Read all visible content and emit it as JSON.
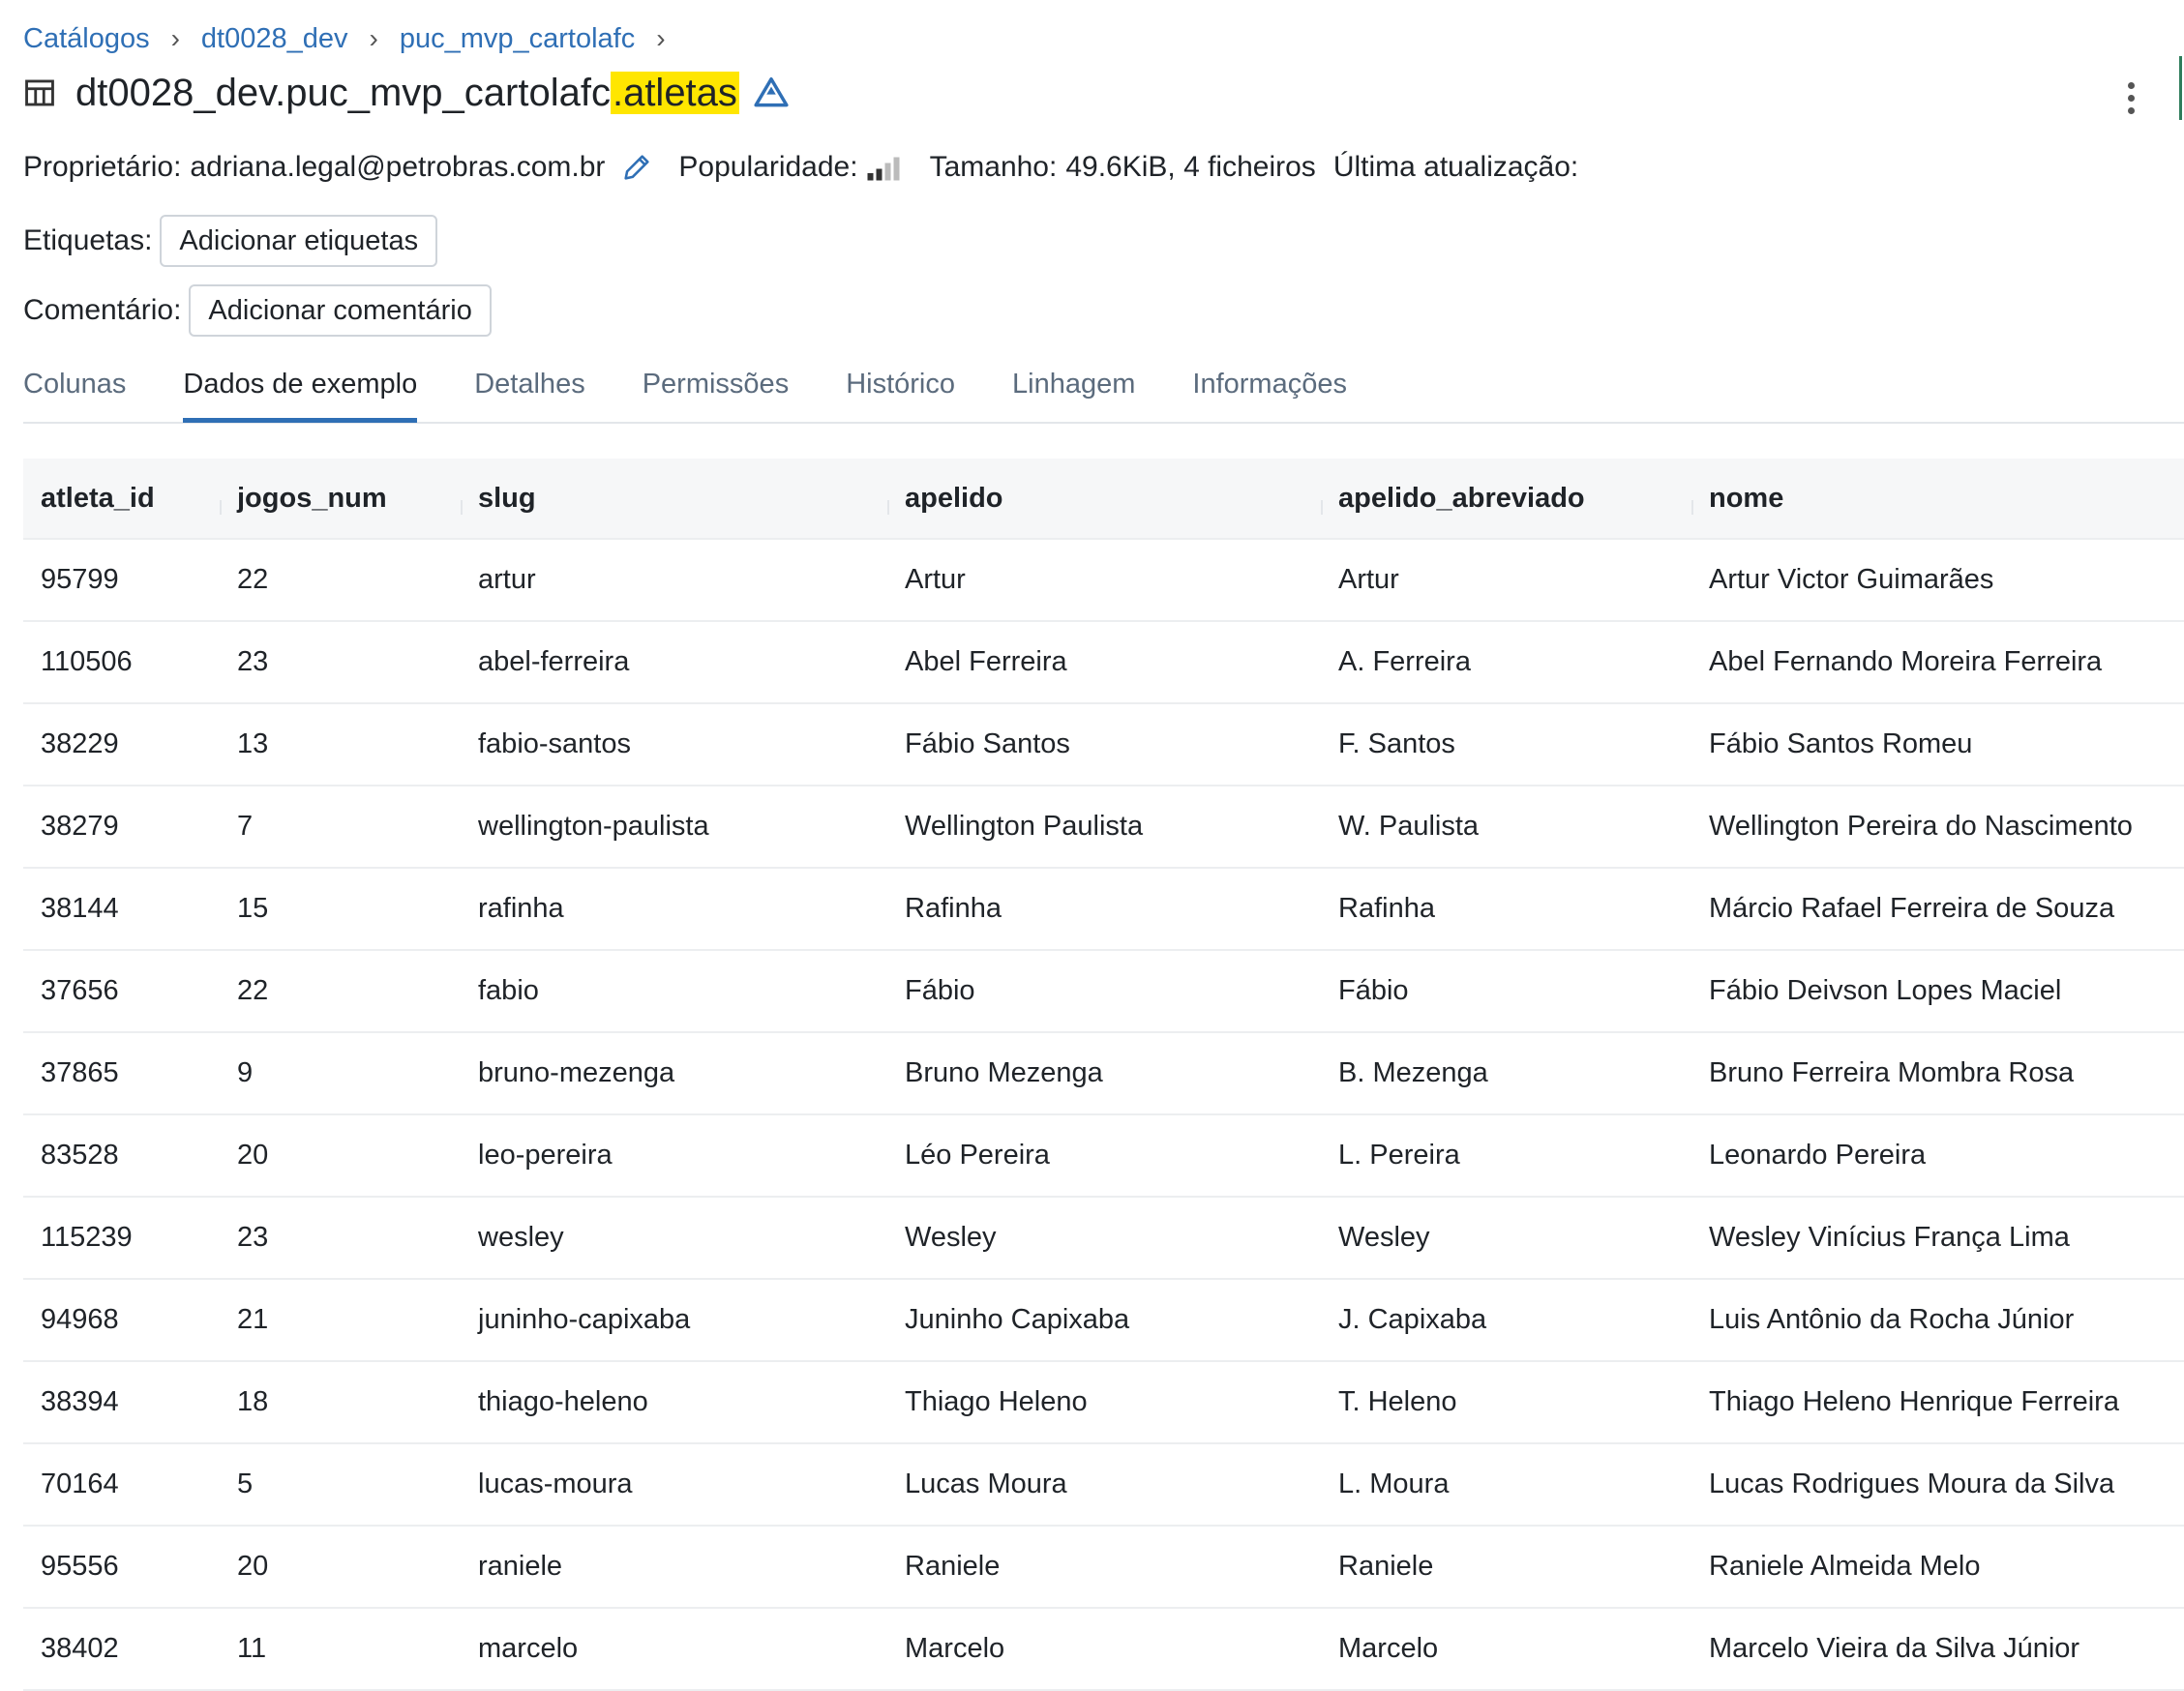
{
  "breadcrumb": [
    "Catálogos",
    "dt0028_dev",
    "puc_mvp_cartolafc"
  ],
  "title": {
    "prefix": "dt0028_dev.puc_mvp_cartolafc",
    "highlight": ".atletas"
  },
  "meta": {
    "owner_label": "Proprietário:",
    "owner_value": "adriana.legal@petrobras.com.br",
    "popularity_label": "Popularidade:",
    "size_label": "Tamanho:",
    "size_value": "49.6KiB, 4 ficheiros",
    "updated_label": "Última atualização:"
  },
  "tags": {
    "label": "Etiquetas:",
    "button": "Adicionar etiquetas"
  },
  "comment": {
    "label": "Comentário:",
    "button": "Adicionar comentário"
  },
  "tabs": [
    {
      "label": "Colunas",
      "active": false
    },
    {
      "label": "Dados de exemplo",
      "active": true
    },
    {
      "label": "Detalhes",
      "active": false
    },
    {
      "label": "Permissões",
      "active": false
    },
    {
      "label": "Histórico",
      "active": false
    },
    {
      "label": "Linhagem",
      "active": false
    },
    {
      "label": "Informações",
      "active": false
    }
  ],
  "table": {
    "columns": [
      "atleta_id",
      "jogos_num",
      "slug",
      "apelido",
      "apelido_abreviado",
      "nome"
    ],
    "rows": [
      [
        "95799",
        "22",
        "artur",
        "Artur",
        "Artur",
        "Artur Victor Guimarães"
      ],
      [
        "110506",
        "23",
        "abel-ferreira",
        "Abel Ferreira",
        "A. Ferreira",
        "Abel Fernando Moreira Ferreira"
      ],
      [
        "38229",
        "13",
        "fabio-santos",
        "Fábio Santos",
        "F. Santos",
        "Fábio Santos Romeu"
      ],
      [
        "38279",
        "7",
        "wellington-paulista",
        "Wellington Paulista",
        "W. Paulista",
        "Wellington Pereira do Nascimento"
      ],
      [
        "38144",
        "15",
        "rafinha",
        "Rafinha",
        "Rafinha",
        "Márcio Rafael Ferreira de Souza"
      ],
      [
        "37656",
        "22",
        "fabio",
        "Fábio",
        "Fábio",
        "Fábio Deivson Lopes Maciel"
      ],
      [
        "37865",
        "9",
        "bruno-mezenga",
        "Bruno Mezenga",
        "B. Mezenga",
        "Bruno Ferreira Mombra Rosa"
      ],
      [
        "83528",
        "20",
        "leo-pereira",
        "Léo Pereira",
        "L. Pereira",
        "Leonardo Pereira"
      ],
      [
        "115239",
        "23",
        "wesley",
        "Wesley",
        "Wesley",
        "Wesley Vinícius França Lima"
      ],
      [
        "94968",
        "21",
        "juninho-capixaba",
        "Juninho Capixaba",
        "J. Capixaba",
        "Luis Antônio da Rocha Júnior"
      ],
      [
        "38394",
        "18",
        "thiago-heleno",
        "Thiago Heleno",
        "T. Heleno",
        "Thiago Heleno Henrique Ferreira"
      ],
      [
        "70164",
        "5",
        "lucas-moura",
        "Lucas Moura",
        "L. Moura",
        "Lucas Rodrigues Moura da Silva"
      ],
      [
        "95556",
        "20",
        "raniele",
        "Raniele",
        "Raniele",
        "Raniele Almeida Melo"
      ],
      [
        "38402",
        "11",
        "marcelo",
        "Marcelo",
        "Marcelo",
        "Marcelo Vieira da Silva Júnior"
      ]
    ]
  },
  "colors": {
    "link": "#2f6fb5",
    "highlight": "#ffe600",
    "active_tab": "#2f6fb5"
  }
}
